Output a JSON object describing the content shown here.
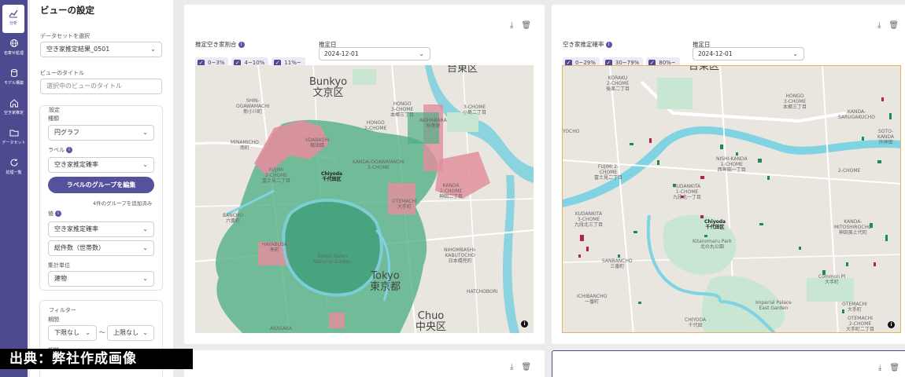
{
  "rail": {
    "items": [
      {
        "label": "分析",
        "icon": "chart-icon"
      },
      {
        "label": "名寄せ処理",
        "icon": "globe-icon"
      },
      {
        "label": "モデル構築",
        "icon": "database-icon"
      },
      {
        "label": "空き家推定",
        "icon": "home-icon"
      },
      {
        "label": "データセット",
        "icon": "folder-icon"
      },
      {
        "label": "処理一覧",
        "icon": "refresh-icon"
      }
    ]
  },
  "panel": {
    "title": "ビューの設定",
    "dataset_label": "データセットを選択",
    "dataset_value": "空き家推定結果_0501",
    "view_title_label": "ビューのタイトル",
    "view_title_placeholder": "選択中のビューのタイトル",
    "settings_heading": "設定",
    "type_label": "種類",
    "type_value": "円グラフ",
    "label_label": "ラベル",
    "label_value": "空き家推定確率",
    "edit_group_button": "ラベルのグループを編集",
    "group_note": "4件のグループを追加済み",
    "value_label": "値",
    "value_1": "空き家推定確率",
    "value_2": "総件数（世帯数）",
    "unit_label": "集計単位",
    "unit_value": "建物",
    "filter_heading": "フィルター",
    "period_label": "期間",
    "period_from": "下限なし",
    "period_sep": "〜",
    "period_to": "上限なし",
    "next_label": "期間"
  },
  "card1": {
    "filter_label": "推定空き家割合",
    "chips": [
      "0~3%",
      "4~10%",
      "11%~"
    ],
    "date_label": "推定日",
    "date_value": "2024-12-01",
    "map_labels": [
      "Bunkyo\n文京区",
      "東京都",
      "Tokyo",
      "Chuo\n中央区",
      "台東区",
      "HONGO\n3-CHOME\n本郷三丁目",
      "Chiyoda\n千代田区",
      "AKIHABARA\n秋葉原",
      "OTEMACHI\n大手町",
      "HAYABUSA\n隼町",
      "AKASAKA",
      "BANCHO\n六番町",
      "SHIN-\nOGAWAMACHI\n新小川町",
      "MINAMICHO\n南町",
      "IIDABASHI\n飯田橋",
      "FUJIMI\n2-CHOME\n富士見二丁目",
      "KANDA-OGAWAMACHI\n3-CHOME",
      "NIHOMBASHI-\nKABUTOCHO\n日本橋兜町",
      "HATCHOBORI",
      "KANDA\n2-CHOME\n神田二丁目",
      "3-CHOME\n小島二丁目",
      "HONGO\n2-CHOME",
      "SHIBA\n秋葉原",
      "Kokyo Gaien\nNational Garden"
    ]
  },
  "card2": {
    "filter_label": "空き家推定確率",
    "chips": [
      "0~29%",
      "30~79%",
      "80%~"
    ],
    "date_label": "推定日",
    "date_value": "2024-12-01",
    "map_labels": [
      "台東区",
      "KORAKU\n2-CHOME\n後楽二丁目",
      "HONGO\n3-CHOME\n本郷三丁目",
      "SOTO-\nKANDA\n外神田",
      "FUJIMI 2-\nCHOME\n富士見二丁目",
      "NISHI-KANDA\n1-CHOME\n西神田一丁目",
      "KUDANKITA\n1-CHOME\n九段北一丁目",
      "Chiyoda\n千代田区",
      "KANDA-\nMITOSHIROCHO\n神田美土代町",
      "KUDANKITA\n3-CHOME\n九段北三丁目",
      "Kitanomaru Park\n北の丸公園",
      "SANBANCHO\n三番町",
      "ICHIBANCHO\n一番町",
      "Imperial Palace\nEast Garden",
      "OTEMACHI\n大手町",
      "CHIYODA\n千代田",
      "Common Pl\n大手町",
      "KANDA-\nSARUGAKUCHO",
      "YOCHO",
      "2-CHOME",
      "OTEMACHI\n2-CHOME\n大手町二丁目"
    ]
  },
  "colors": {
    "rail": "#4e4a8f",
    "primary_button": "#55519a",
    "green_fill": "#4fae84",
    "red_fill": "#e28f9c",
    "map_bg": "#e9e6e0",
    "water": "#7fd3e3",
    "park": "#c8e6d2",
    "selected_border": "#e8b25a"
  },
  "credit": "出典：弊社作成画像"
}
